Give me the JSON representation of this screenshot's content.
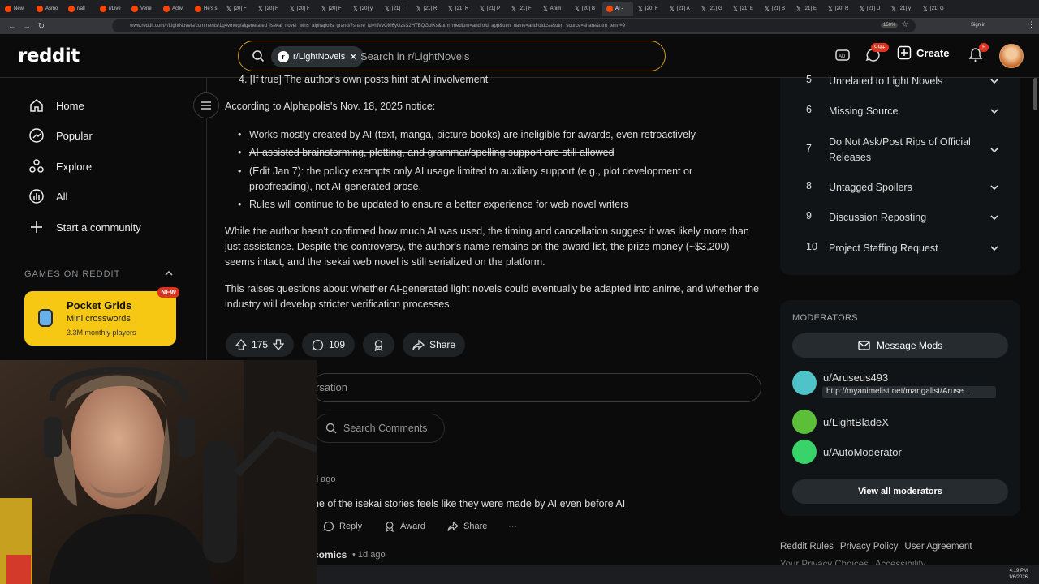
{
  "browser": {
    "tabs": [
      {
        "label": "New",
        "type": "r"
      },
      {
        "label": "Asmo",
        "type": "r"
      },
      {
        "label": "r/all",
        "type": "r"
      },
      {
        "label": "r/Live",
        "type": "r"
      },
      {
        "label": "Vene",
        "type": "r"
      },
      {
        "label": "Activ",
        "type": "r"
      },
      {
        "label": "He's s",
        "type": "r"
      },
      {
        "label": "(20) F",
        "type": "x"
      },
      {
        "label": "(20) F",
        "type": "x"
      },
      {
        "label": "(20) F",
        "type": "x"
      },
      {
        "label": "(20) F",
        "type": "x"
      },
      {
        "label": "(20) y",
        "type": "x"
      },
      {
        "label": "(21) T",
        "type": "x"
      },
      {
        "label": "(21) R",
        "type": "x"
      },
      {
        "label": "(21) R",
        "type": "x"
      },
      {
        "label": "(21) P",
        "type": "x"
      },
      {
        "label": "(21) F",
        "type": "x"
      },
      {
        "label": "Anim",
        "type": "x"
      },
      {
        "label": "(20) B",
        "type": "x"
      },
      {
        "label": "AI -",
        "type": "r",
        "active": true
      },
      {
        "label": "(20) F",
        "type": "x"
      },
      {
        "label": "(21) A",
        "type": "x"
      },
      {
        "label": "(21) G",
        "type": "x"
      },
      {
        "label": "(21) E",
        "type": "x"
      },
      {
        "label": "(21) B",
        "type": "x"
      },
      {
        "label": "(21) E",
        "type": "x"
      },
      {
        "label": "(20) R",
        "type": "x"
      },
      {
        "label": "(21) U",
        "type": "x"
      },
      {
        "label": "(21) y",
        "type": "x"
      },
      {
        "label": "(21) G",
        "type": "x"
      }
    ],
    "url": "www.reddit.com/r/LightNovels/comments/1q4vmwg/aigenerated_isekai_novel_wins_alphapolis_grand/?share_id=hlVvQM6yUzsS2HTBQGpiXs&utm_medium=android_app&utm_name=androidcss&utm_source=share&utm_term=9",
    "zoom": "150%",
    "signin": "Sign in"
  },
  "header": {
    "logo": "reddit",
    "search_chip": "r/LightNovels",
    "search_placeholder": "Search in r/LightNovels",
    "chat_badge": "99+",
    "notif_badge": "5",
    "create_label": "Create"
  },
  "leftnav": {
    "items": [
      {
        "label": "Home",
        "icon": "home-icon"
      },
      {
        "label": "Popular",
        "icon": "popular-icon"
      },
      {
        "label": "Explore",
        "icon": "explore-icon"
      },
      {
        "label": "All",
        "icon": "all-icon"
      },
      {
        "label": "Start a community",
        "icon": "plus-icon"
      }
    ],
    "games_heading": "GAMES ON REDDIT",
    "game": {
      "title": "Pocket Grids",
      "subtitle": "Mini crosswords",
      "players": "3.3M monthly players",
      "badge": "NEW"
    }
  },
  "post": {
    "truncated_item": "4. [If true] The author's own posts hint at AI involvement",
    "notice_intro": "According to Alphapolis's Nov. 18, 2025 notice:",
    "bullets": [
      {
        "text": "Works mostly created by AI (text, manga, picture books) are ineligible for awards, even retroactively",
        "strike": false
      },
      {
        "text": "AI-assisted brainstorming, plotting, and grammar/spelling support are still allowed",
        "strike": true
      },
      {
        "text": "(Edit Jan 7): the policy exempts only AI usage limited to auxiliary support (e.g., plot development or proofreading), not AI-generated prose.",
        "strike": false
      },
      {
        "text": "Rules will continue to be updated to ensure a better experience for web novel writers",
        "strike": false
      }
    ],
    "para1": "While the author hasn't confirmed how much AI was used, the timing and cancellation suggest it was likely more than just assistance. Despite the controversy, the author's name remains on the award list, the prize money (~$3,200) seems intact, and the isekai web novel is still serialized on the platform.",
    "para2": "This raises questions about whether AI-generated light novels could eventually be adapted into anime, and whether the industry will develop stricter verification processes.",
    "votes": "175",
    "comments": "109",
    "share_label": "Share",
    "join_placeholder": "rsation",
    "search_comments": "Search Comments"
  },
  "comments": [
    {
      "meta": "d ago",
      "text": "ne of the isekai stories feels like they were made by AI even before AI",
      "reply": "Reply",
      "award": "Award",
      "share": "Share"
    },
    {
      "author": "comics",
      "meta": "1d ago"
    }
  ],
  "rules": [
    {
      "num": "5",
      "label": "Unrelated to Light Novels"
    },
    {
      "num": "6",
      "label": "Missing Source"
    },
    {
      "num": "7",
      "label": "Do Not Ask/Post Rips of Official Releases"
    },
    {
      "num": "8",
      "label": "Untagged Spoilers"
    },
    {
      "num": "9",
      "label": "Discussion Reposting"
    },
    {
      "num": "10",
      "label": "Project Staffing Request"
    }
  ],
  "moderators": {
    "heading": "MODERATORS",
    "message_label": "Message Mods",
    "list": [
      {
        "name": "u/Aruseus493",
        "flair": "http://myanimelist.net/mangalist/Aruse...",
        "color": "#4fc3c8"
      },
      {
        "name": "u/LightBladeX",
        "color": "#5cbf3a"
      },
      {
        "name": "u/AutoModerator",
        "color": "#38d46a"
      }
    ],
    "view_all": "View all moderators"
  },
  "footer": {
    "links": [
      "Reddit Rules",
      "Privacy Policy",
      "User Agreement"
    ],
    "links2": [
      "Your Privacy Choices",
      "Accessibility"
    ]
  },
  "taskbar": {
    "time": "4:19 PM",
    "date": "1/6/2026"
  },
  "colors": {
    "accent": "#d39a1c",
    "badge": "#e0321c",
    "game_card": "#f6c814"
  }
}
